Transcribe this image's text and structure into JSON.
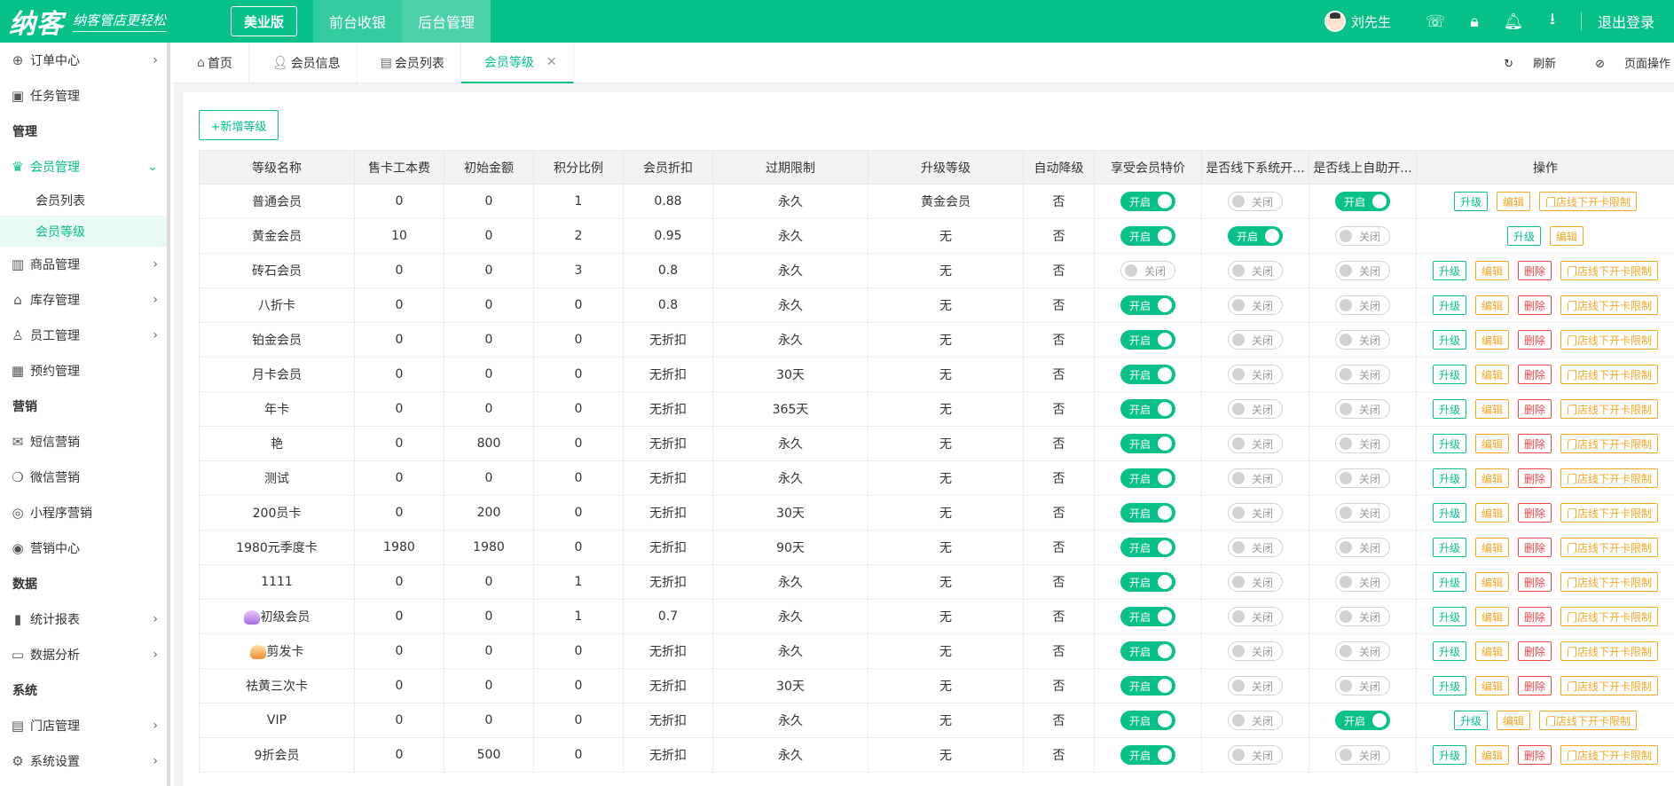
{
  "topbar": {
    "logo_main": "纳客",
    "logo_slogan": "纳客管店更轻松",
    "edition_label": "美业版",
    "tabs": [
      {
        "label": "前台收银"
      },
      {
        "label": "后台管理"
      }
    ],
    "user_name": "刘先生",
    "logout_label": "退出登录"
  },
  "sidebar": {
    "items": [
      {
        "type": "item",
        "label": "订单中心",
        "icon": "globe-icon",
        "arrow": "›"
      },
      {
        "type": "item",
        "label": "任务管理",
        "icon": "task-icon"
      },
      {
        "type": "section",
        "label": "管理"
      },
      {
        "type": "item",
        "label": "会员管理",
        "icon": "crown-icon",
        "arrow": "⌄",
        "active": true
      },
      {
        "type": "sub",
        "label": "会员列表"
      },
      {
        "type": "sub",
        "label": "会员等级",
        "active": true
      },
      {
        "type": "item",
        "label": "商品管理",
        "icon": "goods-icon",
        "arrow": "›"
      },
      {
        "type": "item",
        "label": "库存管理",
        "icon": "warehouse-icon",
        "arrow": "›"
      },
      {
        "type": "item",
        "label": "员工管理",
        "icon": "user-icon",
        "arrow": "›"
      },
      {
        "type": "item",
        "label": "预约管理",
        "icon": "calendar-icon"
      },
      {
        "type": "section",
        "label": "营销"
      },
      {
        "type": "item",
        "label": "短信营销",
        "icon": "mail-icon"
      },
      {
        "type": "item",
        "label": "微信营销",
        "icon": "wechat-icon"
      },
      {
        "type": "item",
        "label": "小程序营销",
        "icon": "miniprogram-icon"
      },
      {
        "type": "item",
        "label": "营销中心",
        "icon": "target-icon"
      },
      {
        "type": "section",
        "label": "数据"
      },
      {
        "type": "item",
        "label": "统计报表",
        "icon": "bar-chart-icon",
        "arrow": "›"
      },
      {
        "type": "item",
        "label": "数据分析",
        "icon": "analysis-icon",
        "arrow": "›"
      },
      {
        "type": "section",
        "label": "系统"
      },
      {
        "type": "item",
        "label": "门店管理",
        "icon": "store-icon",
        "arrow": "›"
      },
      {
        "type": "item",
        "label": "系统设置",
        "icon": "gear-icon",
        "arrow": "›"
      }
    ]
  },
  "page_tabs": {
    "tabs": [
      {
        "label": "首页",
        "icon": "home-icon"
      },
      {
        "label": "会员信息",
        "icon": "user-icon"
      },
      {
        "label": "会员列表",
        "icon": "list-icon"
      },
      {
        "label": "会员等级",
        "active": true,
        "closable": true
      }
    ],
    "refresh_label": "刷新",
    "page_ops_label": "页面操作"
  },
  "main": {
    "add_button_label": "+新增等级",
    "columns": [
      "等级名称",
      "售卡工本费",
      "初始金额",
      "积分比例",
      "会员折扣",
      "过期限制",
      "升级等级",
      "自动降级",
      "享受会员特价",
      "是否线下系统开...",
      "是否线上自助开...",
      "操作"
    ],
    "toggle_on_label": "开启",
    "toggle_off_label": "关闭",
    "op_labels": {
      "upgrade": "升级",
      "edit": "编辑",
      "delete": "删除",
      "limit": "门店线下开卡限制"
    },
    "rows": [
      {
        "name": "普通会员",
        "fee": "0",
        "init": "0",
        "points": "1",
        "discount": "0.88",
        "expire": "永久",
        "upgrade": "黄金会员",
        "auto": "否",
        "special": true,
        "offline": false,
        "online": true,
        "ops": [
          "upgrade",
          "edit",
          "limit"
        ]
      },
      {
        "name": "黄金会员",
        "fee": "10",
        "init": "0",
        "points": "2",
        "discount": "0.95",
        "expire": "永久",
        "upgrade": "无",
        "auto": "否",
        "special": true,
        "offline": true,
        "online": false,
        "ops": [
          "upgrade",
          "edit"
        ]
      },
      {
        "name": "砖石会员",
        "fee": "0",
        "init": "0",
        "points": "3",
        "discount": "0.8",
        "expire": "永久",
        "upgrade": "无",
        "auto": "否",
        "special": false,
        "offline": false,
        "online": false,
        "ops": [
          "upgrade",
          "edit",
          "delete",
          "limit"
        ]
      },
      {
        "name": "八折卡",
        "fee": "0",
        "init": "0",
        "points": "0",
        "discount": "0.8",
        "expire": "永久",
        "upgrade": "无",
        "auto": "否",
        "special": true,
        "offline": false,
        "online": false,
        "ops": [
          "upgrade",
          "edit",
          "delete",
          "limit"
        ]
      },
      {
        "name": "铂金会员",
        "fee": "0",
        "init": "0",
        "points": "0",
        "discount": "无折扣",
        "expire": "永久",
        "upgrade": "无",
        "auto": "否",
        "special": true,
        "offline": false,
        "online": false,
        "ops": [
          "upgrade",
          "edit",
          "delete",
          "limit"
        ]
      },
      {
        "name": "月卡会员",
        "fee": "0",
        "init": "0",
        "points": "0",
        "discount": "无折扣",
        "expire": "30天",
        "upgrade": "无",
        "auto": "否",
        "special": true,
        "offline": false,
        "online": false,
        "ops": [
          "upgrade",
          "edit",
          "delete",
          "limit"
        ]
      },
      {
        "name": "年卡",
        "fee": "0",
        "init": "0",
        "points": "0",
        "discount": "无折扣",
        "expire": "365天",
        "upgrade": "无",
        "auto": "否",
        "special": true,
        "offline": false,
        "online": false,
        "ops": [
          "upgrade",
          "edit",
          "delete",
          "limit"
        ]
      },
      {
        "name": "艳",
        "fee": "0",
        "init": "800",
        "points": "0",
        "discount": "无折扣",
        "expire": "永久",
        "upgrade": "无",
        "auto": "否",
        "special": true,
        "offline": false,
        "online": false,
        "ops": [
          "upgrade",
          "edit",
          "delete",
          "limit"
        ]
      },
      {
        "name": "测试",
        "fee": "0",
        "init": "0",
        "points": "0",
        "discount": "无折扣",
        "expire": "永久",
        "upgrade": "无",
        "auto": "否",
        "special": true,
        "offline": false,
        "online": false,
        "ops": [
          "upgrade",
          "edit",
          "delete",
          "limit"
        ]
      },
      {
        "name": "200员卡",
        "fee": "0",
        "init": "200",
        "points": "0",
        "discount": "无折扣",
        "expire": "30天",
        "upgrade": "无",
        "auto": "否",
        "special": true,
        "offline": false,
        "online": false,
        "ops": [
          "upgrade",
          "edit",
          "delete",
          "limit"
        ]
      },
      {
        "name": "1980元季度卡",
        "fee": "1980",
        "init": "1980",
        "points": "0",
        "discount": "无折扣",
        "expire": "90天",
        "upgrade": "无",
        "auto": "否",
        "special": true,
        "offline": false,
        "online": false,
        "ops": [
          "upgrade",
          "edit",
          "delete",
          "limit"
        ]
      },
      {
        "name": "1111",
        "fee": "0",
        "init": "0",
        "points": "1",
        "discount": "无折扣",
        "expire": "永久",
        "upgrade": "无",
        "auto": "否",
        "special": true,
        "offline": false,
        "online": false,
        "ops": [
          "upgrade",
          "edit",
          "delete",
          "limit"
        ]
      },
      {
        "name": "初级会员",
        "badge": "purple",
        "fee": "0",
        "init": "0",
        "points": "1",
        "discount": "0.7",
        "expire": "永久",
        "upgrade": "无",
        "auto": "否",
        "special": true,
        "offline": false,
        "online": false,
        "ops": [
          "upgrade",
          "edit",
          "delete",
          "limit"
        ]
      },
      {
        "name": "剪发卡",
        "badge": "orange",
        "fee": "0",
        "init": "0",
        "points": "0",
        "discount": "无折扣",
        "expire": "永久",
        "upgrade": "无",
        "auto": "否",
        "special": true,
        "offline": false,
        "online": false,
        "ops": [
          "upgrade",
          "edit",
          "delete",
          "limit"
        ]
      },
      {
        "name": "祛黄三次卡",
        "fee": "0",
        "init": "0",
        "points": "0",
        "discount": "无折扣",
        "expire": "30天",
        "upgrade": "无",
        "auto": "否",
        "special": true,
        "offline": false,
        "online": false,
        "ops": [
          "upgrade",
          "edit",
          "delete",
          "limit"
        ]
      },
      {
        "name": "VIP",
        "fee": "0",
        "init": "0",
        "points": "0",
        "discount": "无折扣",
        "expire": "永久",
        "upgrade": "无",
        "auto": "否",
        "special": true,
        "offline": false,
        "online": true,
        "ops": [
          "upgrade",
          "edit",
          "limit"
        ]
      },
      {
        "name": "9折会员",
        "fee": "0",
        "init": "500",
        "points": "0",
        "discount": "无折扣",
        "expire": "永久",
        "upgrade": "无",
        "auto": "否",
        "special": true,
        "offline": false,
        "online": false,
        "ops": [
          "upgrade",
          "edit",
          "delete",
          "limit"
        ]
      }
    ]
  },
  "colors": {
    "brand": "#07c08a",
    "edit": "#f5a623",
    "delete": "#e8464b"
  }
}
